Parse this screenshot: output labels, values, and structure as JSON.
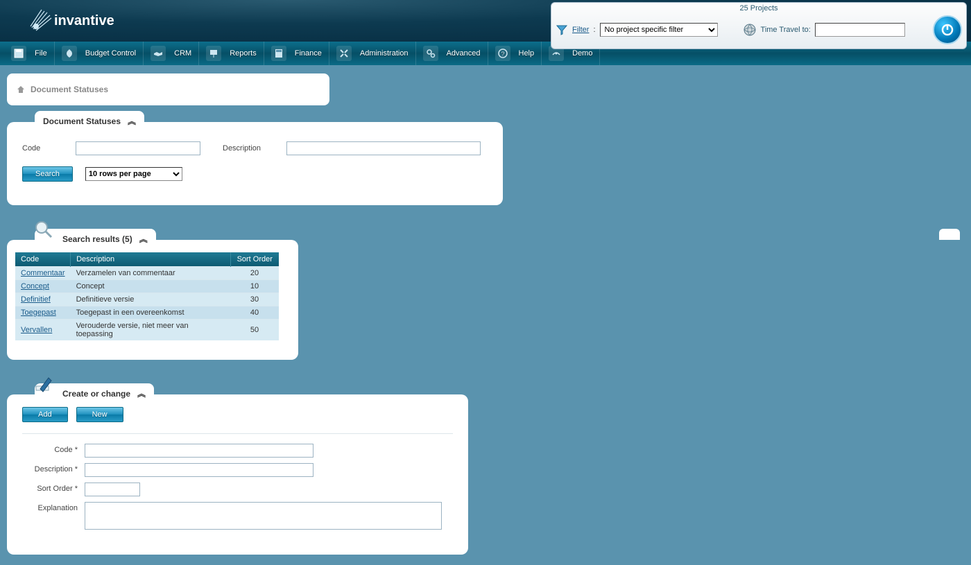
{
  "logo_text": "invantive",
  "top_toolbar": {
    "title": "25 Projects",
    "filter_label": "Filter",
    "filter_select_value": "No project specific filter",
    "timetravel_label": "Time Travel to:",
    "timetravel_value": ""
  },
  "menu": [
    {
      "label": "File"
    },
    {
      "label": "Budget Control"
    },
    {
      "label": "CRM"
    },
    {
      "label": "Reports"
    },
    {
      "label": "Finance"
    },
    {
      "label": "Administration"
    },
    {
      "label": "Advanced"
    },
    {
      "label": "Help"
    },
    {
      "label": "Demo"
    }
  ],
  "breadcrumb": {
    "title": "Document Statuses"
  },
  "search_panel": {
    "title": "Document Statuses",
    "code_label": "Code",
    "description_label": "Description",
    "search_button": "Search",
    "rows_select_value": "10 rows per page"
  },
  "results_panel": {
    "title": "Search results (5)",
    "columns": [
      "Code",
      "Description",
      "Sort Order"
    ],
    "rows": [
      {
        "code": "Commentaar",
        "description": "Verzamelen van commentaar",
        "sort": "20"
      },
      {
        "code": "Concept",
        "description": "Concept",
        "sort": "10"
      },
      {
        "code": "Definitief",
        "description": "Definitieve versie",
        "sort": "30"
      },
      {
        "code": "Toegepast",
        "description": "Toegepast in een overeenkomst",
        "sort": "40"
      },
      {
        "code": "Vervallen",
        "description": "Verouderde versie, niet meer van toepassing",
        "sort": "50"
      }
    ]
  },
  "create_panel": {
    "title": "Create or change",
    "add_button": "Add",
    "new_button": "New",
    "code_label": "Code *",
    "description_label": "Description *",
    "sort_label": "Sort Order *",
    "explanation_label": "Explanation"
  }
}
